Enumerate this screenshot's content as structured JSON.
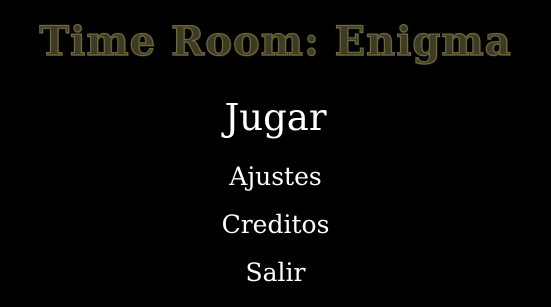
{
  "title": "Time Room: Enigma",
  "menu": {
    "items": [
      {
        "label": "Jugar",
        "selected": true
      },
      {
        "label": "Ajustes",
        "selected": false
      },
      {
        "label": "Creditos",
        "selected": false
      },
      {
        "label": "Salir",
        "selected": false
      }
    ]
  },
  "colors": {
    "background": "#000000",
    "title_fill": "#3f3a23",
    "title_outline": "#6d6a3c",
    "menu_text": "#ffffff"
  }
}
